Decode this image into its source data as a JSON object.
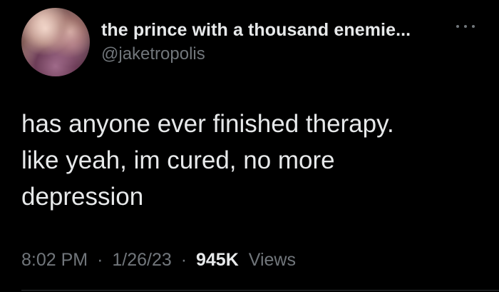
{
  "tweet": {
    "author": {
      "display_name": "the prince with a thousand enemie...",
      "handle": "@jaketropolis",
      "avatar_icon": "avatar-photo"
    },
    "more_icon": "more-horizontal-icon",
    "text_lines": [
      "has anyone ever finished therapy.",
      "like yeah, im cured, no more",
      "depression"
    ],
    "time": "8:02 PM",
    "separator": "·",
    "date": "1/26/23",
    "views_count": "945K",
    "views_label": "Views"
  },
  "colors": {
    "background": "#000000",
    "primary_text": "#e7e9ea",
    "secondary_text": "#71767b"
  }
}
